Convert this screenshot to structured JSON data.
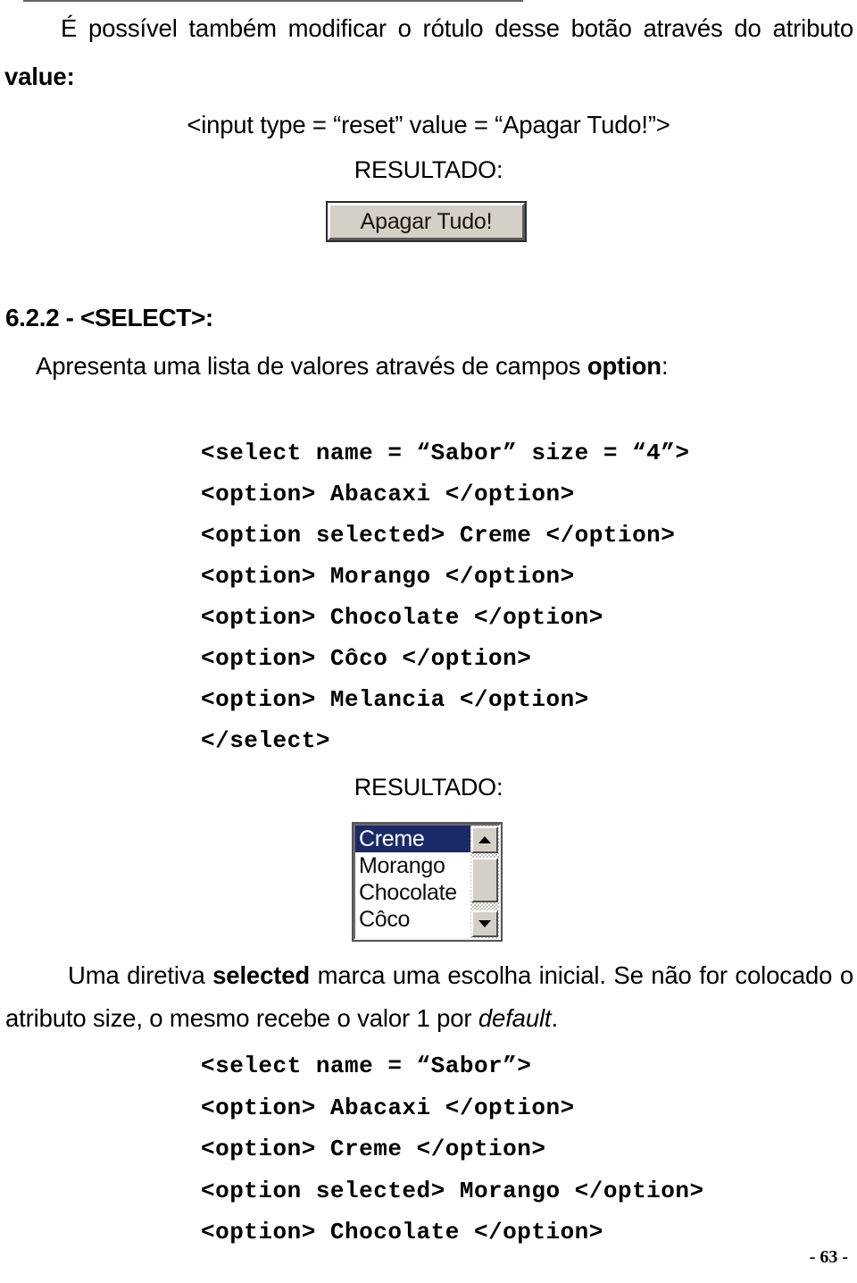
{
  "document": {
    "page_number": "- 63 -",
    "language": "pt-BR"
  },
  "paragraph_reset": {
    "line1": "É possível também modificar o rótulo desse botão através do atributo",
    "bold_term": "value",
    "colon": ":"
  },
  "code_reset": {
    "line": "<input type = “reset” value = “Apagar Tudo!”>"
  },
  "result_label_1": "RESULTADO:",
  "reset_button": {
    "label": "Apagar Tudo!",
    "face_color": "#d4d0c8",
    "highlight_color": "#ffffff",
    "shadow_color": "#5a5a5a",
    "text_color": "#1a1208"
  },
  "section": {
    "heading": "6.2.2 - <SELECT>:",
    "intro_prefix": "Apresenta uma lista de valores através de campos ",
    "intro_bold": "option",
    "intro_suffix": ":"
  },
  "code_select_size4": {
    "lines": [
      "<select name = “Sabor” size = “4”>",
      "<option> Abacaxi </option>",
      "<option selected> Creme </option>",
      "<option> Morango </option>",
      "<option> Chocolate </option>",
      "<option> Côco </option>",
      "<option> Melancia </option>",
      "</select>"
    ]
  },
  "result_label_2": "RESULTADO:",
  "listbox": {
    "items": [
      {
        "label": "Creme",
        "selected": true
      },
      {
        "label": "Morango",
        "selected": false
      },
      {
        "label": "Chocolate",
        "selected": false
      },
      {
        "label": "Côco",
        "selected": false
      }
    ],
    "selected_value": "Creme",
    "visible_rows": 4,
    "highlight_color": "#1b2a66",
    "highlight_text_color": "#ffffff",
    "background_color": "#ffffff",
    "scrollbar": {
      "up_arrow": "scroll-up-arrow",
      "down_arrow": "scroll-down-arrow",
      "thumb": "scroll-thumb"
    }
  },
  "paragraph_selected": {
    "part1": "Uma diretiva ",
    "bold1": "selected",
    "part2": " marca uma escolha inicial. Se não for colocado o",
    "part3": "atributo size, o mesmo recebe o valor 1 por ",
    "italic1": "default",
    "part4": "."
  },
  "code_select_default": {
    "lines": [
      "<select name = “Sabor”>",
      "<option> Abacaxi </option>",
      "<option> Creme </option>",
      "<option selected> Morango </option>",
      "<option> Chocolate </option>"
    ]
  }
}
